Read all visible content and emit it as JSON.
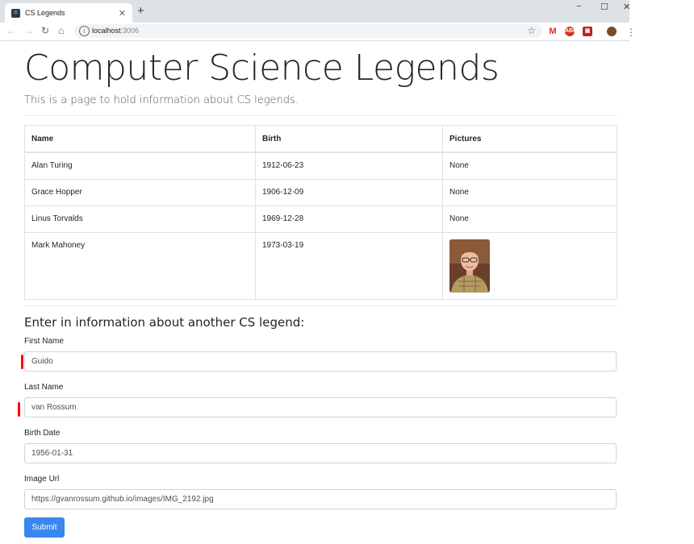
{
  "browser": {
    "tab_title": "CS Legends",
    "tab_close": "✕",
    "new_tab": "+",
    "url_host": "localhost",
    "url_port": ":3006",
    "window_controls": [
      "−",
      "☐",
      "✕"
    ]
  },
  "page": {
    "title": "Computer Science Legends",
    "lead": "This is a page to hold information about CS legends."
  },
  "table": {
    "headers": [
      "Name",
      "Birth",
      "Pictures"
    ],
    "rows": [
      {
        "name": "Alan Turing",
        "birth": "1912-06-23",
        "picture": "None"
      },
      {
        "name": "Grace Hopper",
        "birth": "1906-12-09",
        "picture": "None"
      },
      {
        "name": "Linus Torvalds",
        "birth": "1969-12-28",
        "picture": "None"
      },
      {
        "name": "Mark Mahoney",
        "birth": "1973-03-19",
        "picture": "photo"
      }
    ]
  },
  "form": {
    "heading": "Enter in information about another CS legend:",
    "first_name_label": "First Name",
    "first_name_value": "Guido",
    "last_name_label": "Last Name",
    "last_name_value": "van Rossum",
    "birth_date_label": "Birth Date",
    "birth_date_value": "1956-01-31",
    "image_url_label": "Image Url",
    "image_url_value": "https://gvanrossum.github.io/images/IMG_2192.jpg",
    "submit_label": "Submit"
  },
  "colors": {
    "primary": "#3a87ef",
    "marker": "#ff0000"
  }
}
